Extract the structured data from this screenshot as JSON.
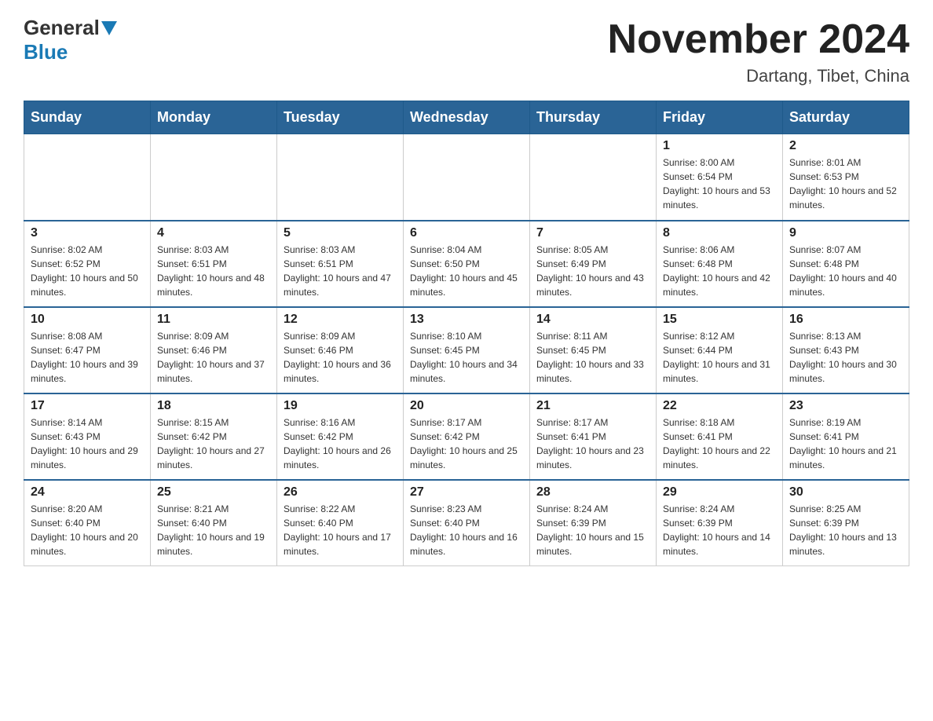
{
  "header": {
    "logo_general": "General",
    "logo_blue": "Blue",
    "title": "November 2024",
    "subtitle": "Dartang, Tibet, China"
  },
  "days_of_week": [
    "Sunday",
    "Monday",
    "Tuesday",
    "Wednesday",
    "Thursday",
    "Friday",
    "Saturday"
  ],
  "weeks": [
    [
      {
        "day": "",
        "info": ""
      },
      {
        "day": "",
        "info": ""
      },
      {
        "day": "",
        "info": ""
      },
      {
        "day": "",
        "info": ""
      },
      {
        "day": "",
        "info": ""
      },
      {
        "day": "1",
        "info": "Sunrise: 8:00 AM\nSunset: 6:54 PM\nDaylight: 10 hours and 53 minutes."
      },
      {
        "day": "2",
        "info": "Sunrise: 8:01 AM\nSunset: 6:53 PM\nDaylight: 10 hours and 52 minutes."
      }
    ],
    [
      {
        "day": "3",
        "info": "Sunrise: 8:02 AM\nSunset: 6:52 PM\nDaylight: 10 hours and 50 minutes."
      },
      {
        "day": "4",
        "info": "Sunrise: 8:03 AM\nSunset: 6:51 PM\nDaylight: 10 hours and 48 minutes."
      },
      {
        "day": "5",
        "info": "Sunrise: 8:03 AM\nSunset: 6:51 PM\nDaylight: 10 hours and 47 minutes."
      },
      {
        "day": "6",
        "info": "Sunrise: 8:04 AM\nSunset: 6:50 PM\nDaylight: 10 hours and 45 minutes."
      },
      {
        "day": "7",
        "info": "Sunrise: 8:05 AM\nSunset: 6:49 PM\nDaylight: 10 hours and 43 minutes."
      },
      {
        "day": "8",
        "info": "Sunrise: 8:06 AM\nSunset: 6:48 PM\nDaylight: 10 hours and 42 minutes."
      },
      {
        "day": "9",
        "info": "Sunrise: 8:07 AM\nSunset: 6:48 PM\nDaylight: 10 hours and 40 minutes."
      }
    ],
    [
      {
        "day": "10",
        "info": "Sunrise: 8:08 AM\nSunset: 6:47 PM\nDaylight: 10 hours and 39 minutes."
      },
      {
        "day": "11",
        "info": "Sunrise: 8:09 AM\nSunset: 6:46 PM\nDaylight: 10 hours and 37 minutes."
      },
      {
        "day": "12",
        "info": "Sunrise: 8:09 AM\nSunset: 6:46 PM\nDaylight: 10 hours and 36 minutes."
      },
      {
        "day": "13",
        "info": "Sunrise: 8:10 AM\nSunset: 6:45 PM\nDaylight: 10 hours and 34 minutes."
      },
      {
        "day": "14",
        "info": "Sunrise: 8:11 AM\nSunset: 6:45 PM\nDaylight: 10 hours and 33 minutes."
      },
      {
        "day": "15",
        "info": "Sunrise: 8:12 AM\nSunset: 6:44 PM\nDaylight: 10 hours and 31 minutes."
      },
      {
        "day": "16",
        "info": "Sunrise: 8:13 AM\nSunset: 6:43 PM\nDaylight: 10 hours and 30 minutes."
      }
    ],
    [
      {
        "day": "17",
        "info": "Sunrise: 8:14 AM\nSunset: 6:43 PM\nDaylight: 10 hours and 29 minutes."
      },
      {
        "day": "18",
        "info": "Sunrise: 8:15 AM\nSunset: 6:42 PM\nDaylight: 10 hours and 27 minutes."
      },
      {
        "day": "19",
        "info": "Sunrise: 8:16 AM\nSunset: 6:42 PM\nDaylight: 10 hours and 26 minutes."
      },
      {
        "day": "20",
        "info": "Sunrise: 8:17 AM\nSunset: 6:42 PM\nDaylight: 10 hours and 25 minutes."
      },
      {
        "day": "21",
        "info": "Sunrise: 8:17 AM\nSunset: 6:41 PM\nDaylight: 10 hours and 23 minutes."
      },
      {
        "day": "22",
        "info": "Sunrise: 8:18 AM\nSunset: 6:41 PM\nDaylight: 10 hours and 22 minutes."
      },
      {
        "day": "23",
        "info": "Sunrise: 8:19 AM\nSunset: 6:41 PM\nDaylight: 10 hours and 21 minutes."
      }
    ],
    [
      {
        "day": "24",
        "info": "Sunrise: 8:20 AM\nSunset: 6:40 PM\nDaylight: 10 hours and 20 minutes."
      },
      {
        "day": "25",
        "info": "Sunrise: 8:21 AM\nSunset: 6:40 PM\nDaylight: 10 hours and 19 minutes."
      },
      {
        "day": "26",
        "info": "Sunrise: 8:22 AM\nSunset: 6:40 PM\nDaylight: 10 hours and 17 minutes."
      },
      {
        "day": "27",
        "info": "Sunrise: 8:23 AM\nSunset: 6:40 PM\nDaylight: 10 hours and 16 minutes."
      },
      {
        "day": "28",
        "info": "Sunrise: 8:24 AM\nSunset: 6:39 PM\nDaylight: 10 hours and 15 minutes."
      },
      {
        "day": "29",
        "info": "Sunrise: 8:24 AM\nSunset: 6:39 PM\nDaylight: 10 hours and 14 minutes."
      },
      {
        "day": "30",
        "info": "Sunrise: 8:25 AM\nSunset: 6:39 PM\nDaylight: 10 hours and 13 minutes."
      }
    ]
  ]
}
